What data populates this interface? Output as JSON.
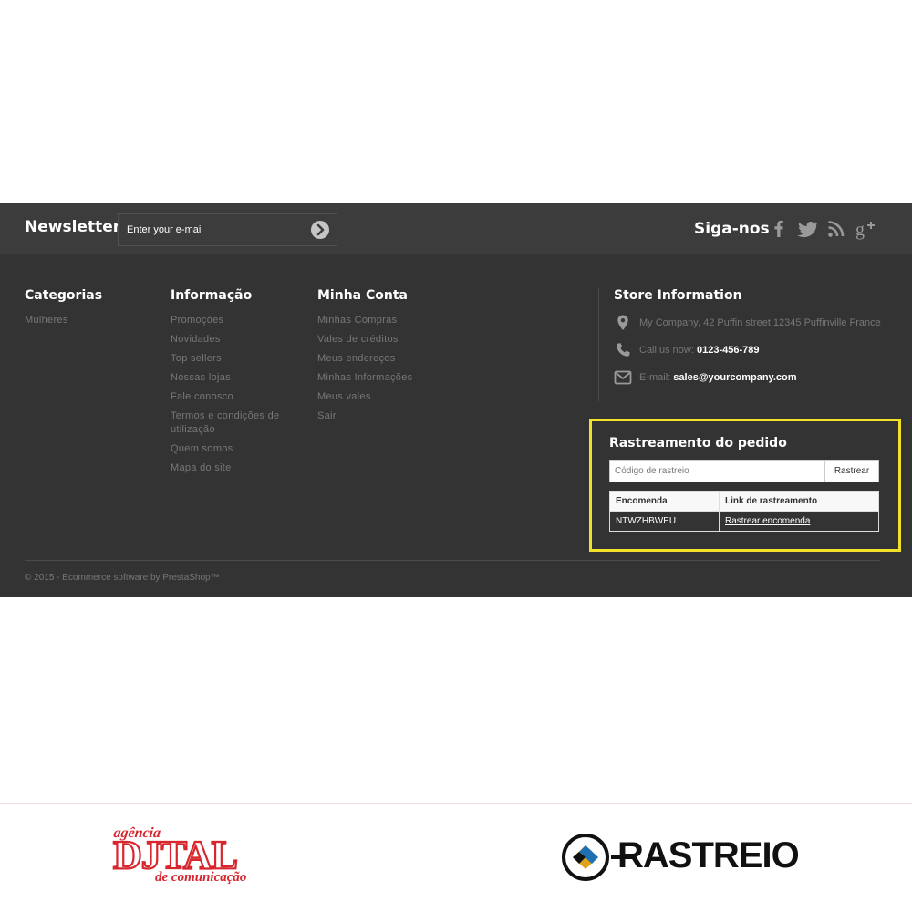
{
  "newsletter": {
    "title": "Newsletter",
    "placeholder": "Enter your e-mail"
  },
  "social": {
    "title": "Siga-nos",
    "icons": [
      "facebook-icon",
      "twitter-icon",
      "rss-icon",
      "google-plus-icon"
    ]
  },
  "columns": {
    "categories": {
      "title": "Categorias",
      "items": [
        "Mulheres"
      ]
    },
    "info": {
      "title": "Informação",
      "items": [
        "Promoções",
        "Novidades",
        "Top sellers",
        "Nossas lojas",
        "Fale conosco",
        "Termos e condições de utilização",
        "Quem somos",
        "Mapa do site"
      ]
    },
    "account": {
      "title": "Minha Conta",
      "items": [
        "Minhas Compras",
        "Vales de créditos",
        "Meus endereços",
        "Minhas Informações",
        "Meus vales",
        "Sair"
      ]
    }
  },
  "store": {
    "title": "Store Information",
    "address": "My Company, 42 Puffin street 12345 Puffinville France",
    "phone_label": "Call us now:",
    "phone": "0123-456-789",
    "email_label": "E-mail:",
    "email": "sales@yourcompany.com"
  },
  "tracking": {
    "title": "Rastreamento do pedido",
    "placeholder": "Código de rastreio",
    "button": "Rastrear",
    "headers": [
      "Encomenda",
      "Link de rastreamento"
    ],
    "rows": [
      {
        "order": "NTWZHBWEU",
        "link": "Rastrear encomenda"
      }
    ]
  },
  "copyright": "© 2015 - Ecommerce software by PrestaShop™",
  "logos": {
    "agency": {
      "line1": "agência",
      "line2": "DJTAL",
      "line3": "de comunicação"
    },
    "rastreio": "RASTREIO"
  },
  "colors": {
    "footer_bg": "#333333",
    "bar_bg": "#3c3c3c",
    "highlight": "#f1e12a",
    "brand_red": "#d7262e",
    "brand_gold": "#e0a21c",
    "brand_blue": "#1f6fb5"
  }
}
